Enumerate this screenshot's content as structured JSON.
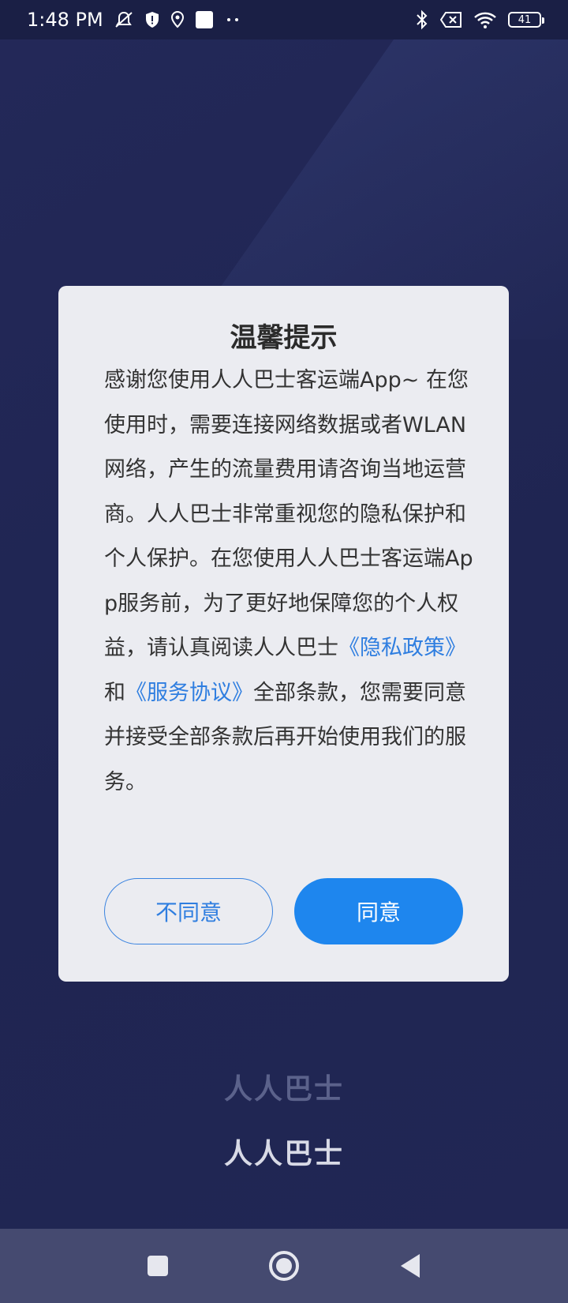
{
  "status_bar": {
    "time": "1:48 PM",
    "battery": "41",
    "icons": [
      "notification-off-icon",
      "shield-icon",
      "location-icon",
      "square-icon",
      "more-dots-icon",
      "bluetooth-icon",
      "no-sim-icon",
      "wifi-icon",
      "battery-icon"
    ]
  },
  "dialog": {
    "title": "温馨提示",
    "body_part1": "感谢您使用人人巴士客运端App~ 在您使用时，需要连接网络数据或者WLAN网络，产生的流量费用请咨询当地运营商。人人巴士非常重视您的隐私保护和个人保护。在您使用人人巴士客运端App服务前，为了更好地保障您的个人权益，请认真阅读人人巴士",
    "privacy_link": "《隐私政策》",
    "and_text": "和",
    "service_link": "《服务协议》",
    "body_part2": "全部条款，您需要同意并接受全部条款后再开始使用我们的服务。",
    "disagree_label": "不同意",
    "agree_label": "同意"
  },
  "brand": {
    "logo_text": "人人巴士"
  },
  "colors": {
    "accent": "#1e86ee",
    "link": "#2f7ee0",
    "background": "#222754"
  }
}
